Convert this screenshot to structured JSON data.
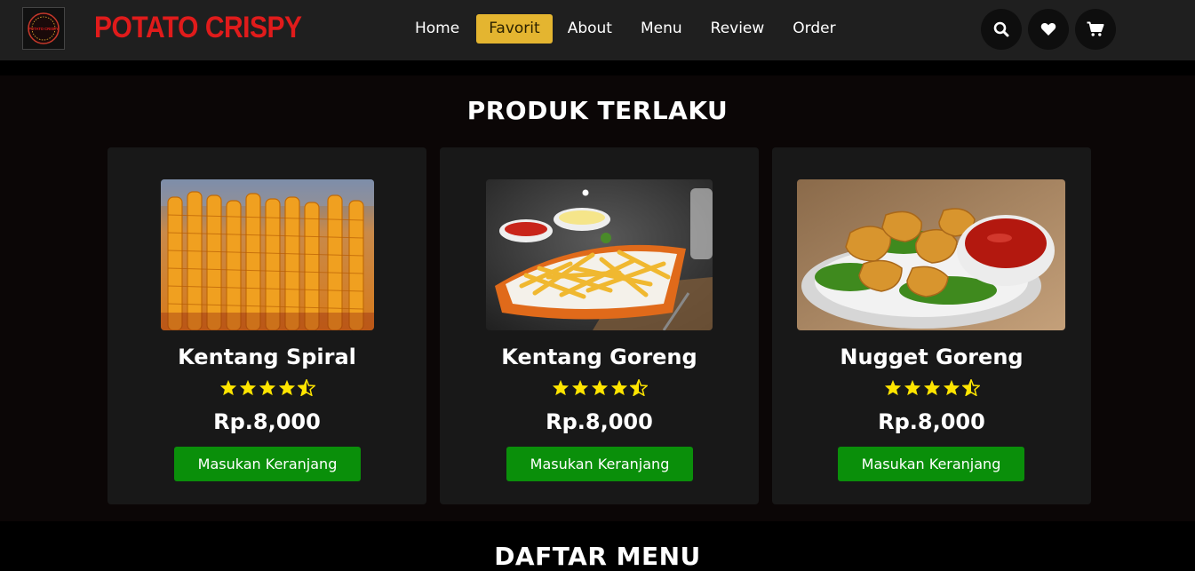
{
  "header": {
    "brand": "POTATO CRISPY",
    "logo_text": "POTATO CRISPY",
    "nav": [
      {
        "label": "Home"
      },
      {
        "label": "Favorit",
        "active": true
      },
      {
        "label": "About"
      },
      {
        "label": "Menu"
      },
      {
        "label": "Review"
      },
      {
        "label": "Order"
      }
    ],
    "icons": [
      "search-icon",
      "heart-icon",
      "cart-icon"
    ]
  },
  "best_sellers": {
    "title": "PRODUK TERLAKU",
    "products": [
      {
        "name": "Kentang Spiral",
        "price": "Rp.8,000",
        "rating": 4.5,
        "button": "Masukan Keranjang"
      },
      {
        "name": "Kentang Goreng",
        "price": "Rp.8,000",
        "rating": 4.5,
        "button": "Masukan Keranjang"
      },
      {
        "name": "Nugget Goreng",
        "price": "Rp.8,000",
        "rating": 4.5,
        "button": "Masukan Keranjang"
      }
    ]
  },
  "menu_section": {
    "title": "DAFTAR MENU"
  },
  "colors": {
    "brand": "#e01b1b",
    "active_nav": "#e4b530",
    "button": "#0a8f0a",
    "star": "#ffe500"
  }
}
